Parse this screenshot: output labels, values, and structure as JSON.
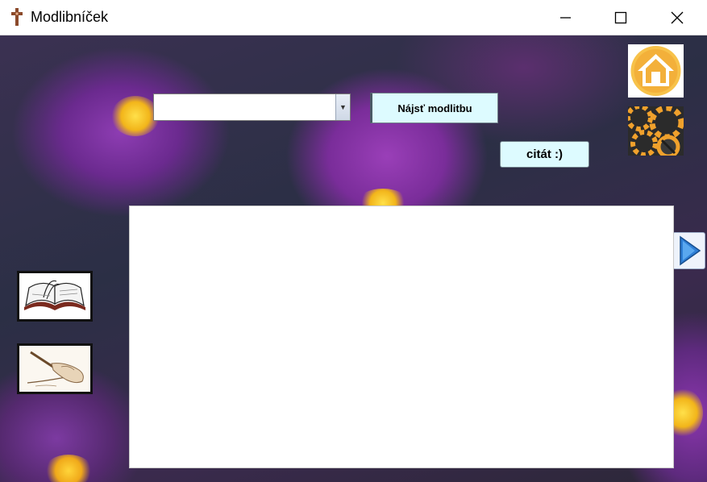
{
  "window": {
    "title": "Modlibníček",
    "minimize_symbol": "—",
    "maximize_symbol": "☐",
    "close_symbol": "✕"
  },
  "prayer_select": {
    "value": "",
    "arrow": "▼"
  },
  "buttons": {
    "find_prayer": "Nájsť modlitbu",
    "quote": "citát :)"
  },
  "prayer_text": {
    "content": ""
  },
  "icons": {
    "app": "cross-icon",
    "home": "home-icon",
    "settings": "gear-icon",
    "next": "next-arrow-icon",
    "book": "open-book-icon",
    "write": "writing-hand-icon"
  },
  "colors": {
    "button_bg": "#ddfbff",
    "flower_purple": "#8e3db3",
    "flower_yellow": "#f2b51a",
    "home_orange": "#f6b13a",
    "arrow_blue": "#2e7fd6"
  }
}
